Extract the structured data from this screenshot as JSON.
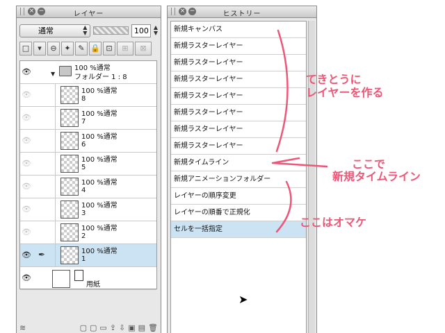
{
  "layer_panel": {
    "title": "レイヤー",
    "blend_mode": "通常",
    "opacity": "100",
    "layers": [
      {
        "name": "100 %通常",
        "sub": "フォルダー 1 : 8",
        "type": "folder",
        "visible": true
      },
      {
        "name": "100 %通常",
        "sub": "8",
        "type": "raster",
        "visible": false
      },
      {
        "name": "100 %通常",
        "sub": "7",
        "type": "raster",
        "visible": false
      },
      {
        "name": "100 %通常",
        "sub": "6",
        "type": "raster",
        "visible": false
      },
      {
        "name": "100 %通常",
        "sub": "5",
        "type": "raster",
        "visible": false
      },
      {
        "name": "100 %通常",
        "sub": "4",
        "type": "raster",
        "visible": false
      },
      {
        "name": "100 %通常",
        "sub": "3",
        "type": "raster",
        "visible": false
      },
      {
        "name": "100 %通常",
        "sub": "2",
        "type": "raster",
        "visible": false
      },
      {
        "name": "100 %通常",
        "sub": "1",
        "type": "raster",
        "visible": true,
        "selected": true
      },
      {
        "name": "用紙",
        "type": "paper",
        "visible": true
      }
    ]
  },
  "history_panel": {
    "title": "ヒストリー",
    "items": [
      "新規キャンバス",
      "新規ラスターレイヤー",
      "新規ラスターレイヤー",
      "新規ラスターレイヤー",
      "新規ラスターレイヤー",
      "新規ラスターレイヤー",
      "新規ラスターレイヤー",
      "新規ラスターレイヤー",
      "新規タイムライン",
      "新規アニメーションフォルダー",
      "レイヤーの順序変更",
      "レイヤーの順番で正規化",
      "セルを一括指定"
    ],
    "selected_index": 12
  },
  "annotations": {
    "note1": "てきとうに\nレイヤーを作る",
    "note2_line1": "ここで",
    "note2_line2": "新規タイムライン",
    "note3": "ここはオマケ",
    "color": "#ef5576"
  }
}
